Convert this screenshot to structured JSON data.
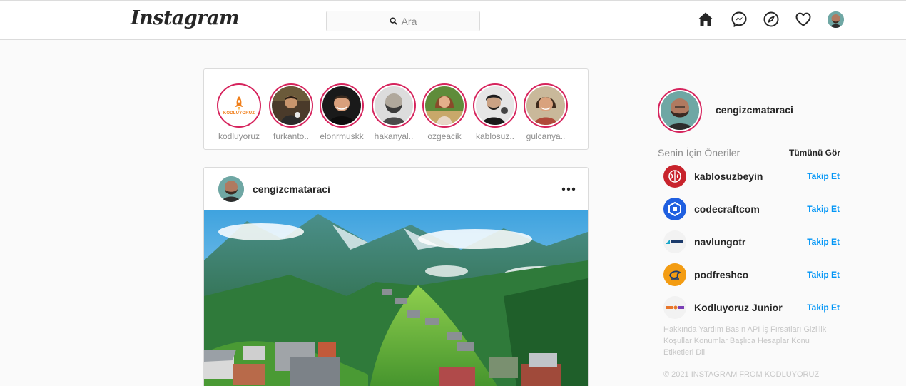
{
  "header": {
    "logo": "Instagram",
    "search_placeholder": "Ara",
    "icons": [
      "home-icon",
      "messenger-icon",
      "explore-icon",
      "heart-icon",
      "profile-avatar"
    ]
  },
  "stories": [
    {
      "name": "kodluyoruz",
      "avatar_text": "KODLUYORUZ"
    },
    {
      "name": "furkanto.."
    },
    {
      "name": "elonrmuskk"
    },
    {
      "name": "hakanyal.."
    },
    {
      "name": "ozgeacik"
    },
    {
      "name": "kablosuz.."
    },
    {
      "name": "gulcanya.."
    }
  ],
  "post": {
    "username": "cengizcmataraci"
  },
  "sidebar": {
    "profile_name": "cengizcmataraci",
    "suggestions_title": "Senin İçin Öneriler",
    "see_all": "Tümünü Gör",
    "suggestions": [
      {
        "name": "kablosuzbeyin",
        "action": "Takip Et",
        "color": "#c8232c"
      },
      {
        "name": "codecraftcom",
        "action": "Takip Et",
        "color": "#1f5fe0"
      },
      {
        "name": "navlungotr",
        "action": "Takip Et",
        "color": "#f2f2f2"
      },
      {
        "name": "podfreshco",
        "action": "Takip Et",
        "color": "#f39c12"
      },
      {
        "name": "Kodluyoruz Junior",
        "action": "Takip Et",
        "color": "#f2f2f2"
      }
    ],
    "footer_links": "Hakkında Yardım Basın API İş Fırsatları Gizlilik Koşullar Konumlar Başlıca Hesaplar Konu Etiketleri Dil",
    "copyright": "© 2021 INSTAGRAM FROM KODLUYORUZ"
  },
  "colors": {
    "story_ring": "#d6245d",
    "follow": "#0095f6"
  }
}
